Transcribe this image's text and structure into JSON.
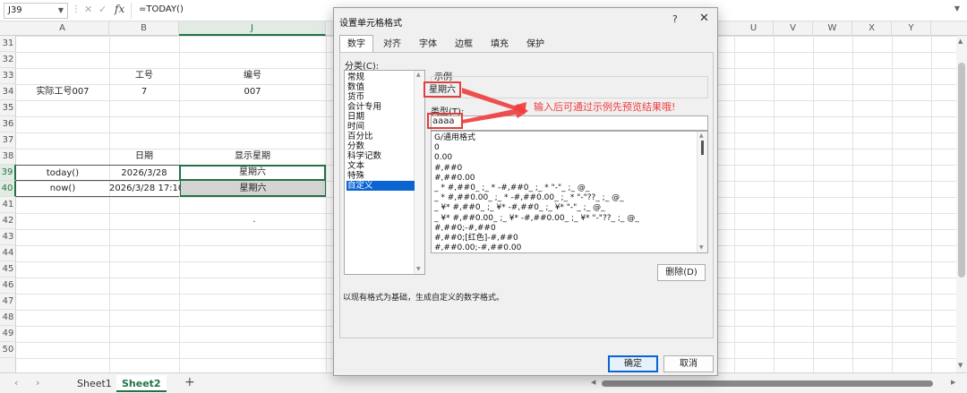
{
  "formula_bar": {
    "name_box": "J39",
    "formula": "=TODAY()",
    "fx": "fx"
  },
  "columns": [
    {
      "label": "A",
      "active": false
    },
    {
      "label": "B",
      "active": false
    },
    {
      "label": "J",
      "active": true
    },
    {
      "label": "T",
      "active": false
    },
    {
      "label": "U",
      "active": false
    },
    {
      "label": "V",
      "active": false
    },
    {
      "label": "W",
      "active": false
    },
    {
      "label": "X",
      "active": false
    },
    {
      "label": "Y",
      "active": false
    }
  ],
  "rows": [
    "31",
    "32",
    "33",
    "34",
    "35",
    "36",
    "37",
    "38",
    "39",
    "40",
    "41",
    "42",
    "43",
    "44",
    "45",
    "46",
    "47",
    "48",
    "49",
    "50"
  ],
  "active_rows": [
    "39",
    "40"
  ],
  "cells": {
    "b33": "工号",
    "j33": "编号",
    "a34": "实际工号007",
    "b34": "7",
    "j34": "007",
    "b38": "日期",
    "j38": "显示星期",
    "a39": "today()",
    "b39": "2026/3/28",
    "j39": "星期六",
    "a40": "now()",
    "b40": "2026/3/28 17:10",
    "j40": "星期六",
    "dot": "·"
  },
  "sheets": [
    {
      "name": "Sheet1",
      "active": false
    },
    {
      "name": "Sheet2",
      "active": true
    }
  ],
  "add_sheet": "+",
  "dialog": {
    "title": "设置单元格格式",
    "help": "?",
    "close": "✕",
    "tabs": [
      {
        "label": "数字",
        "active": true
      },
      {
        "label": "对齐",
        "active": false
      },
      {
        "label": "字体",
        "active": false
      },
      {
        "label": "边框",
        "active": false
      },
      {
        "label": "填充",
        "active": false
      },
      {
        "label": "保护",
        "active": false
      }
    ],
    "category_label": "分类(C):",
    "categories": [
      {
        "label": "常规",
        "selected": false
      },
      {
        "label": "数值",
        "selected": false
      },
      {
        "label": "货币",
        "selected": false
      },
      {
        "label": "会计专用",
        "selected": false
      },
      {
        "label": "日期",
        "selected": false
      },
      {
        "label": "时间",
        "selected": false
      },
      {
        "label": "百分比",
        "selected": false
      },
      {
        "label": "分数",
        "selected": false
      },
      {
        "label": "科学记数",
        "selected": false
      },
      {
        "label": "文本",
        "selected": false
      },
      {
        "label": "特殊",
        "selected": false
      },
      {
        "label": "自定义",
        "selected": true
      }
    ],
    "sample_label": "示例",
    "sample_value": "星期六",
    "type_label": "类型(T):",
    "type_value": "aaaa",
    "formats": [
      "G/通用格式",
      "0",
      "0.00",
      "#,##0",
      "#,##0.00",
      "_ * #,##0_ ;_ * -#,##0_ ;_ * \"-\"_ ;_ @_",
      "_ * #,##0.00_ ;_ * -#,##0.00_ ;_ * \"-\"??_ ;_ @_",
      "_ ¥* #,##0_ ;_ ¥* -#,##0_ ;_ ¥* \"-\"_ ;_ @_",
      "_ ¥* #,##0.00_ ;_ ¥* -#,##0.00_ ;_ ¥* \"-\"??_ ;_ @_",
      "#,##0;-#,##0",
      "#,##0;[红色]-#,##0",
      "#,##0.00;-#,##0.00"
    ],
    "delete_label": "删除(D)",
    "description": "以现有格式为基础，生成自定义的数字格式。",
    "ok_label": "确定",
    "cancel_label": "取消"
  },
  "annotation": {
    "text": "输入后可通过示例先预览结果哦!",
    "color": "#f03c3c"
  },
  "colors": {
    "excel_green": "#217346",
    "select_blue": "#0a64d2",
    "highlight_red": "#e04040"
  }
}
